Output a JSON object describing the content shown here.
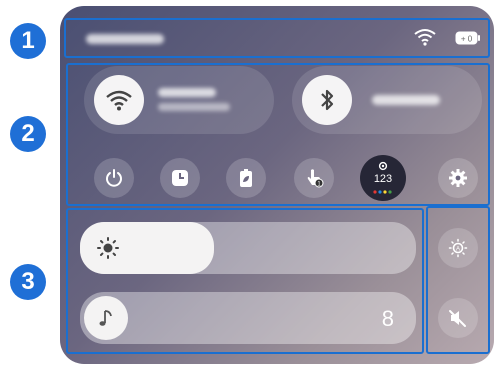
{
  "badges": [
    "1",
    "2",
    "3"
  ],
  "status_bar": {
    "wifi_icon": "wifi-icon",
    "battery_icon": "battery-icon"
  },
  "tiles": [
    {
      "name": "wifi",
      "icon": "wifi-icon"
    },
    {
      "name": "bluetooth",
      "icon": "bluetooth-icon"
    }
  ],
  "quick_buttons": [
    "power-icon",
    "clock-icon",
    "battery-saver-icon",
    "touch-icon",
    "input-method-icon",
    "gear-icon"
  ],
  "input_method": {
    "label": "123"
  },
  "brightness": {
    "level": 0.4,
    "icon": "sun-icon"
  },
  "volume": {
    "value": "8",
    "icon": "music-note-icon"
  },
  "side_icons": [
    "auto-brightness-icon",
    "mute-icon"
  ],
  "colors": {
    "accent": "#1f6fd6",
    "dot_red": "#e53935",
    "dot_blue": "#1e88e5",
    "dot_yellow": "#fdd835",
    "dot_green": "#43a047"
  }
}
